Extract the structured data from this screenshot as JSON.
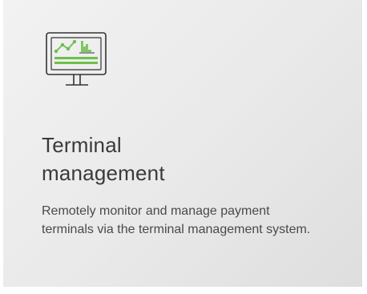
{
  "card": {
    "icon": "monitor-chart-icon",
    "title_line1": "Terminal",
    "title_line2": "management",
    "description": "Remotely monitor and manage payment terminals via the terminal management system."
  },
  "colors": {
    "accent_green": "#6cc04a",
    "icon_stroke": "#333333",
    "title_text": "#3a3a3a",
    "body_text": "#4a4a4a"
  }
}
